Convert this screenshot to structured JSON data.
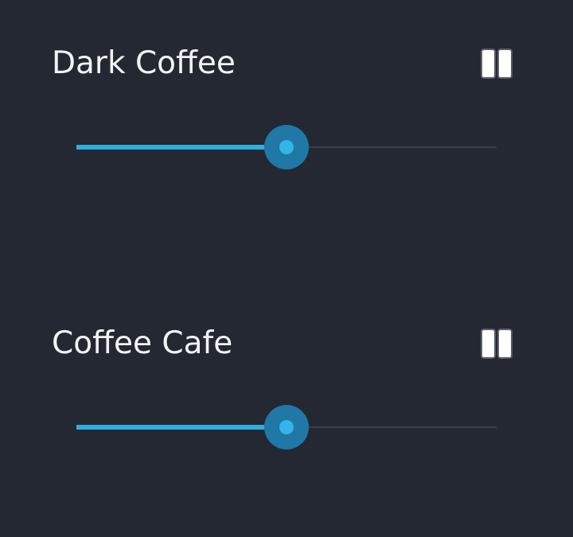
{
  "colors": {
    "background": "#232833",
    "title_text": "#f2f3f5",
    "accent": "#2eaee0",
    "thumb_halo": "#1f78a6",
    "track_inactive": "#3a3f49",
    "pause_icon_fill": "#ffffff",
    "pause_icon_border": "#5a5f68"
  },
  "sounds": [
    {
      "title": "Dark Coffee",
      "control_icon": "pause-icon",
      "volume_fraction": 0.5
    },
    {
      "title": "Coffee Cafe",
      "control_icon": "pause-icon",
      "volume_fraction": 0.5
    }
  ]
}
